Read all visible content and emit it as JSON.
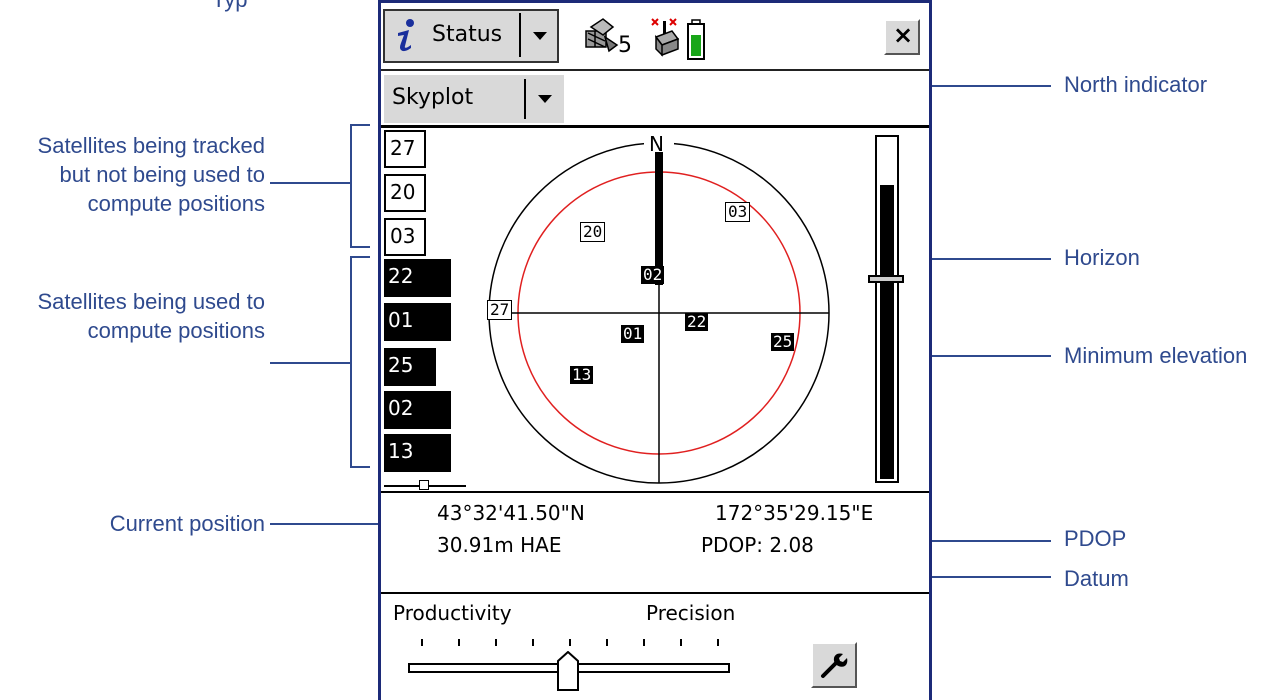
{
  "annotations": {
    "top_fragment": "Typ",
    "tracked_not_used": [
      "Satellites being tracked",
      "but not being used to",
      "compute positions"
    ],
    "used": [
      "Satellites being used to",
      "compute positions"
    ],
    "current_position": "Current position",
    "north_indicator": "North indicator",
    "horizon": "Horizon",
    "minimum_elevation": "Minimum elevation",
    "pdop": "PDOP",
    "datum": "Datum"
  },
  "header": {
    "status_label": "Status",
    "satellite_count": "5",
    "close_label": "×"
  },
  "view_select": {
    "selected": "Skyplot"
  },
  "satellite_list": {
    "tracked_not_used": [
      "27",
      "20",
      "03"
    ],
    "used": [
      "22",
      "01",
      "25",
      "02",
      "13"
    ]
  },
  "skyplot": {
    "north_label": "N",
    "satellites": [
      {
        "id": "20",
        "used": false
      },
      {
        "id": "03",
        "used": false
      },
      {
        "id": "02",
        "used": true
      },
      {
        "id": "27",
        "used": false
      },
      {
        "id": "01",
        "used": true
      },
      {
        "id": "22",
        "used": true
      },
      {
        "id": "25",
        "used": true
      },
      {
        "id": "13",
        "used": true
      }
    ],
    "colors": {
      "horizon": "#000000",
      "minimum_elevation": "#e02020"
    }
  },
  "position": {
    "latitude": "43°32'41.50\"N",
    "longitude": "172°35'29.15\"E",
    "height": "30.91m HAE",
    "pdop": "PDOP: 2.08"
  },
  "slider": {
    "left_label": "Productivity",
    "right_label": "Precision"
  },
  "icons": {
    "info": "info-icon",
    "satellite": "satellite-icon",
    "antenna": "antenna-icon",
    "battery": "battery-icon",
    "close": "close-icon",
    "wrench": "wrench-icon"
  }
}
